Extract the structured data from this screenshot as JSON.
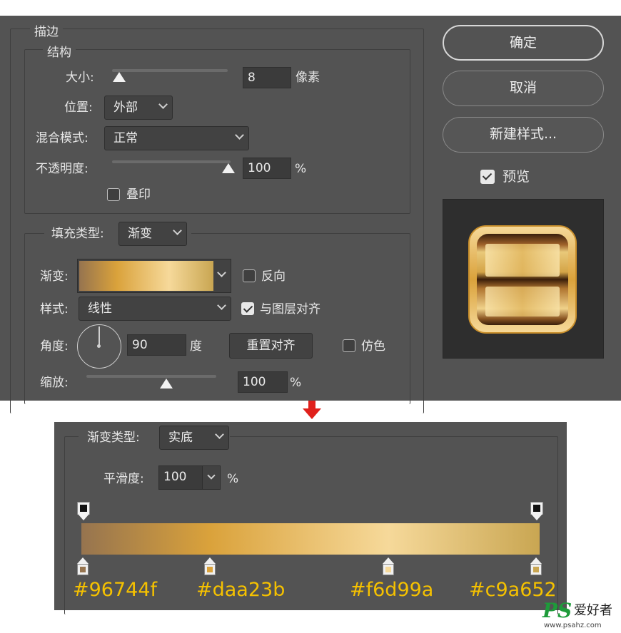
{
  "dialog": {
    "stroke_title": "描边",
    "structure": {
      "title": "结构",
      "size_label": "大小:",
      "size_value": "8",
      "size_unit": "像素",
      "position_label": "位置:",
      "position_value": "外部",
      "blend_label": "混合模式:",
      "blend_value": "正常",
      "opacity_label": "不透明度:",
      "opacity_value": "100",
      "opacity_unit": "%",
      "overprint_label": "叠印",
      "overprint_checked": false
    },
    "fill": {
      "type_label": "填充类型:",
      "type_value": "渐变",
      "gradient_label": "渐变:",
      "reverse_label": "反向",
      "reverse_checked": false,
      "style_label": "样式:",
      "style_value": "线性",
      "align_label": "与图层对齐",
      "align_checked": true,
      "angle_label": "角度:",
      "angle_value": "90",
      "angle_unit": "度",
      "reset_align_label": "重置对齐",
      "dither_label": "仿色",
      "dither_checked": false,
      "scale_label": "缩放:",
      "scale_value": "100",
      "scale_unit": "%"
    },
    "buttons": {
      "ok": "确定",
      "cancel": "取消",
      "new_style": "新建样式...",
      "preview_label": "预览",
      "preview_checked": true
    }
  },
  "gradient_editor": {
    "type_label": "渐变类型:",
    "type_value": "实底",
    "smoothness_label": "平滑度:",
    "smoothness_value": "100",
    "smoothness_unit": "%",
    "color_stops": [
      {
        "hex": "#96744f",
        "location_pct": 0
      },
      {
        "hex": "#daa23b",
        "location_pct": 28
      },
      {
        "hex": "#f6d99a",
        "location_pct": 67
      },
      {
        "hex": "#c9a652",
        "location_pct": 100
      }
    ],
    "opacity_stops": [
      {
        "location_pct": 0
      },
      {
        "location_pct": 100
      }
    ]
  },
  "watermark": {
    "logo_text": "PS",
    "site_name": "爱好者",
    "url": "www.psahz.com"
  },
  "colors": {
    "panel_bg": "#535353",
    "hex_label": "#f5c100",
    "arrow": "#e0201b"
  }
}
